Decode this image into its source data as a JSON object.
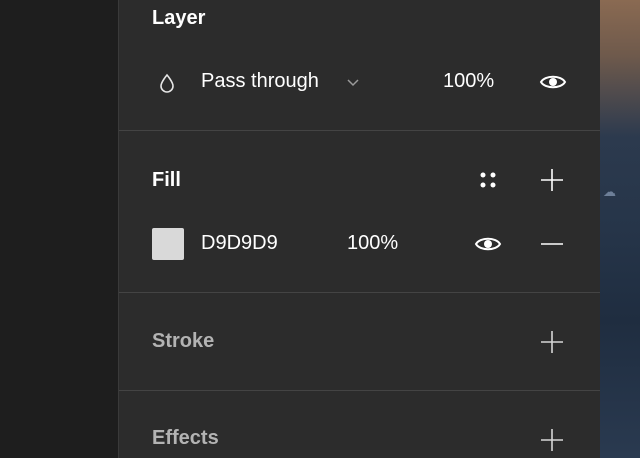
{
  "layer": {
    "title": "Layer",
    "blend_mode": "Pass through",
    "opacity": "100%",
    "icons": {
      "blend": "drop-icon",
      "dropdown": "chevron-down-icon",
      "visibility": "eye-icon"
    }
  },
  "fill": {
    "title": "Fill",
    "color_hex": "D9D9D9",
    "swatch_color": "#D9D9D9",
    "opacity": "100%",
    "icons": {
      "styles": "styles-grid-icon",
      "add": "plus-icon",
      "visibility": "eye-icon",
      "remove": "minus-icon"
    }
  },
  "stroke": {
    "title": "Stroke",
    "icons": {
      "add": "plus-icon"
    }
  },
  "effects": {
    "title": "Effects",
    "icons": {
      "add": "plus-icon"
    }
  },
  "colors": {
    "panel_bg": "#2c2c2c",
    "text": "#ffffff",
    "dim_text": "#b3b3b3"
  }
}
